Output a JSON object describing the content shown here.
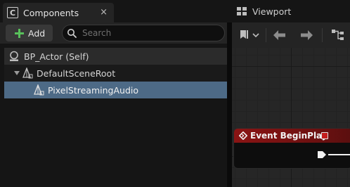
{
  "components_panel": {
    "tab_title": "Components",
    "tab_icon": "blueprint-c-icon",
    "close_glyph": "×",
    "add_label": "Add",
    "search": {
      "placeholder": "Search",
      "value": ""
    },
    "tree": [
      {
        "label": "BP_Actor (Self)",
        "icon": "actor-self-icon",
        "depth": 0,
        "selected": false
      },
      {
        "label": "DefaultSceneRoot",
        "icon": "scene-component-icon",
        "depth": 1,
        "expanded": true,
        "selected": false
      },
      {
        "label": "PixelStreamingAudio",
        "icon": "audio-component-icon",
        "depth": 2,
        "selected": true
      }
    ]
  },
  "viewport": {
    "tab_title": "Viewport",
    "tab_icon": "viewport-grid-icon",
    "toolbar_icons": [
      "bookmark-icon",
      "chevron-down-icon",
      "back-arrow-icon",
      "forward-arrow-icon",
      "hierarchy-icon"
    ]
  },
  "graph": {
    "node": {
      "title": "Event BeginPlay",
      "header_color": "#8a1414"
    }
  },
  "colors": {
    "accent_selection": "#4d6a86",
    "add_icon": "#58c05b",
    "panel_bg": "#151515",
    "toolbar_bg": "#242424"
  }
}
